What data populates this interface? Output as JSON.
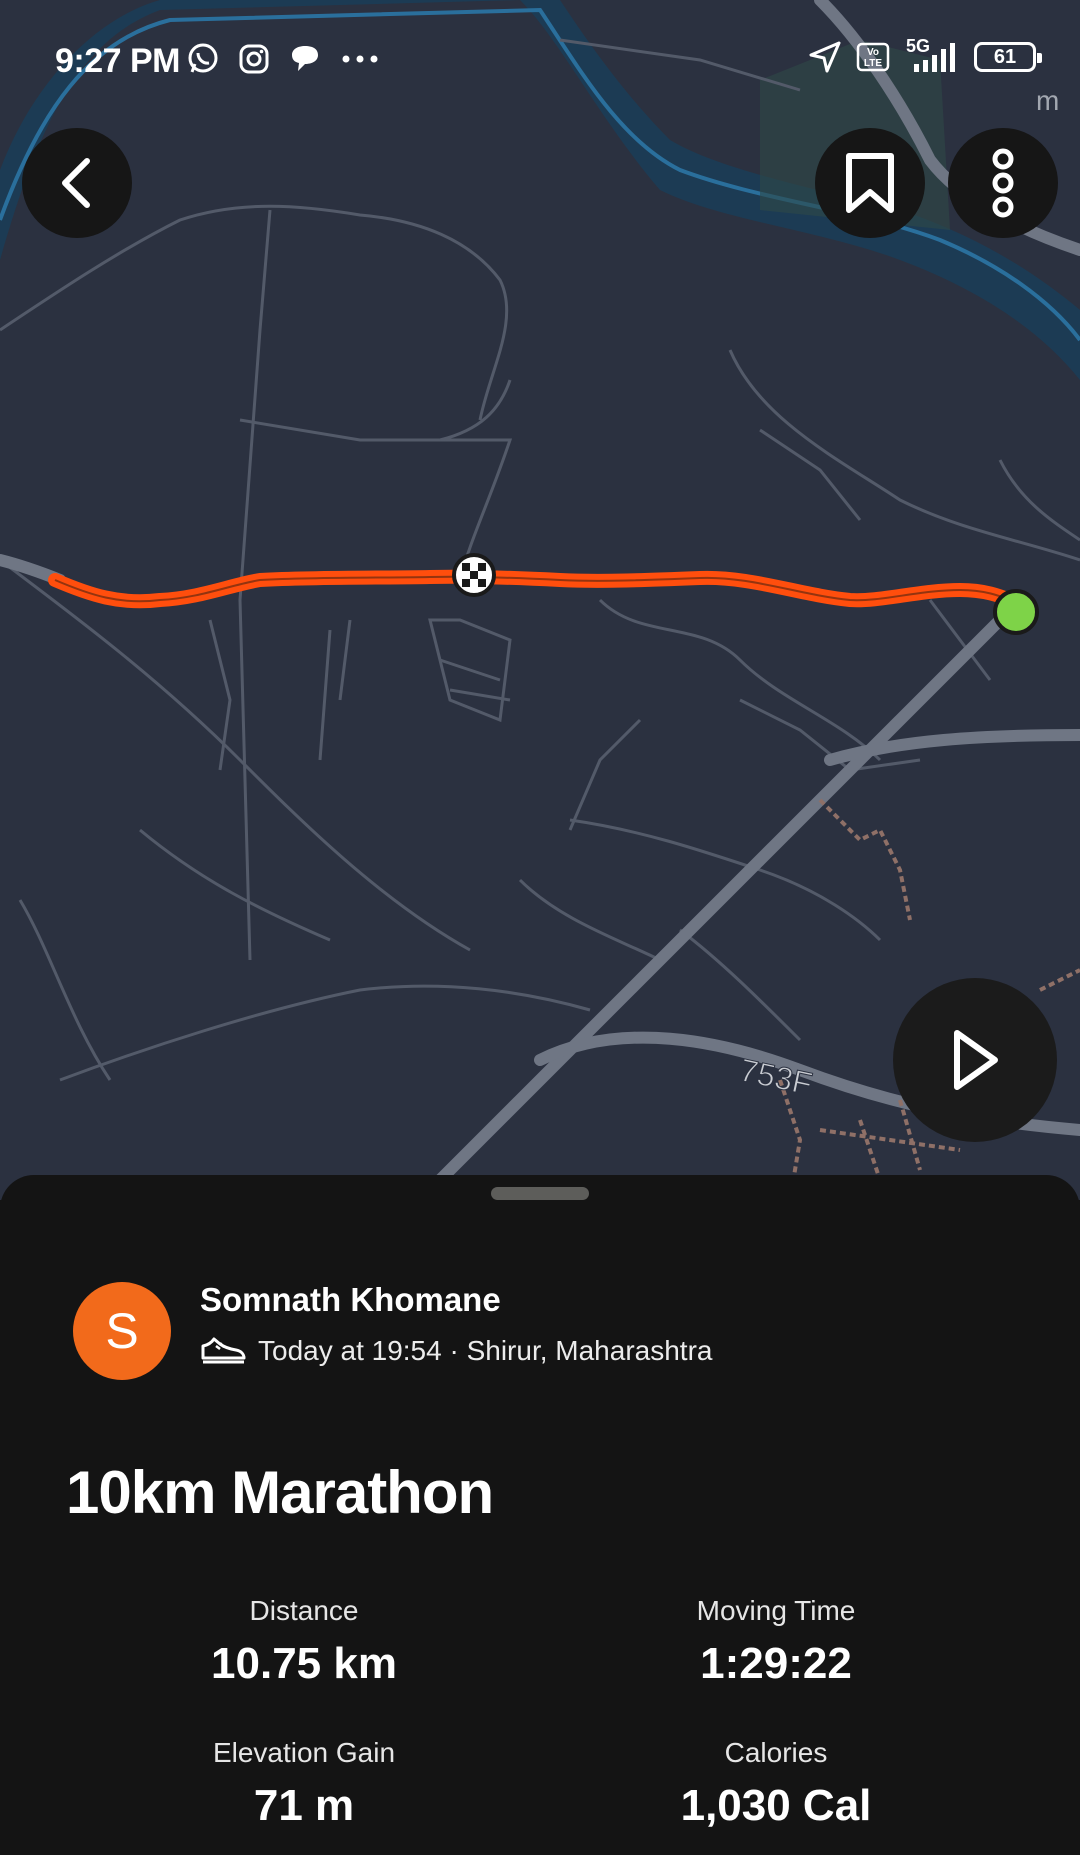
{
  "status_bar": {
    "time": "9:27 PM",
    "left_icons": [
      "whatsapp-icon",
      "instagram-icon",
      "chat-bubble-icon",
      "more-dots-icon"
    ],
    "right_icons": [
      "location-arrow-icon",
      "volte-icon",
      "signal-icon",
      "battery-icon"
    ],
    "volte_label": "Vo LTE",
    "network": "5G",
    "battery": "61"
  },
  "map": {
    "road_label": "753F",
    "scale_fragment": "m",
    "colors": {
      "background": "#2b3140",
      "river": "#1d4f73",
      "roads": "#6f7684",
      "route": "#ff4e0d",
      "start_marker": "#7ed348"
    }
  },
  "toolbar": {
    "back": "chevron-left-icon",
    "bookmark": "bookmark-icon",
    "more": "vertical-dots-icon",
    "play": "play-icon"
  },
  "activity": {
    "athlete_initial": "S",
    "athlete_name": "Somnath Khomane",
    "sport_icon": "shoe-icon",
    "meta": "Today at 19:54 · Shirur, Maharashtra",
    "title": "10km Marathon",
    "stats": {
      "distance": {
        "label": "Distance",
        "value": "10.75 km"
      },
      "moving_time": {
        "label": "Moving Time",
        "value": "1:29:22"
      },
      "elevation_gain": {
        "label": "Elevation Gain",
        "value": "71 m"
      },
      "calories": {
        "label": "Calories",
        "value": "1,030 Cal"
      }
    },
    "avatar_color": "#f26a1b"
  }
}
